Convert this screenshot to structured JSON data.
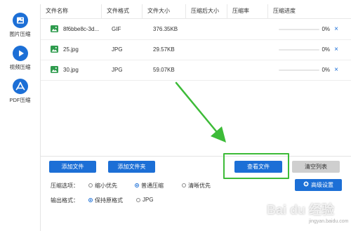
{
  "sidebar": {
    "items": [
      {
        "label": "图片压缩",
        "icon": "image-icon"
      },
      {
        "label": "视频压缩",
        "icon": "play-icon"
      },
      {
        "label": "PDF压缩",
        "icon": "pdf-icon"
      }
    ]
  },
  "table": {
    "headers": [
      "文件名称",
      "文件格式",
      "文件大小",
      "压缩后大小",
      "压缩率",
      "压缩进度"
    ],
    "rows": [
      {
        "name": "8f6bbe8c-3d...",
        "format": "GIF",
        "size": "376.35KB",
        "compressed_size": "",
        "ratio": "",
        "progress": "0%",
        "progress_value": 0,
        "delete": "×"
      },
      {
        "name": "25.jpg",
        "format": "JPG",
        "size": "29.57KB",
        "compressed_size": "",
        "ratio": "",
        "progress": "0%",
        "progress_value": 0,
        "delete": "×"
      },
      {
        "name": "30.jpg",
        "format": "JPG",
        "size": "59.07KB",
        "compressed_size": "",
        "ratio": "",
        "progress": "0%",
        "progress_value": 0,
        "delete": "×"
      }
    ]
  },
  "buttons": {
    "add_file": "添加文件",
    "add_folder": "添加文件夹",
    "view_file": "查看文件",
    "clear_list": "清空列表",
    "advanced": "高级设置"
  },
  "options": {
    "compress_label": "压缩选项：",
    "compress_choices": [
      {
        "label": "缩小优先",
        "selected": false
      },
      {
        "label": "普通压缩",
        "selected": true
      },
      {
        "label": "清晰优先",
        "selected": false
      }
    ],
    "output_label": "输出格式：",
    "output_choices": [
      {
        "label": "保持原格式",
        "selected": true
      },
      {
        "label": "JPG",
        "selected": false
      }
    ]
  },
  "watermark": {
    "text": "Bai du 经验",
    "sub": "jingyan.baidu.com"
  },
  "colors": {
    "accent": "#1c6fd6",
    "highlight": "#3dbb38",
    "file_icon": "#2e9b4d"
  }
}
